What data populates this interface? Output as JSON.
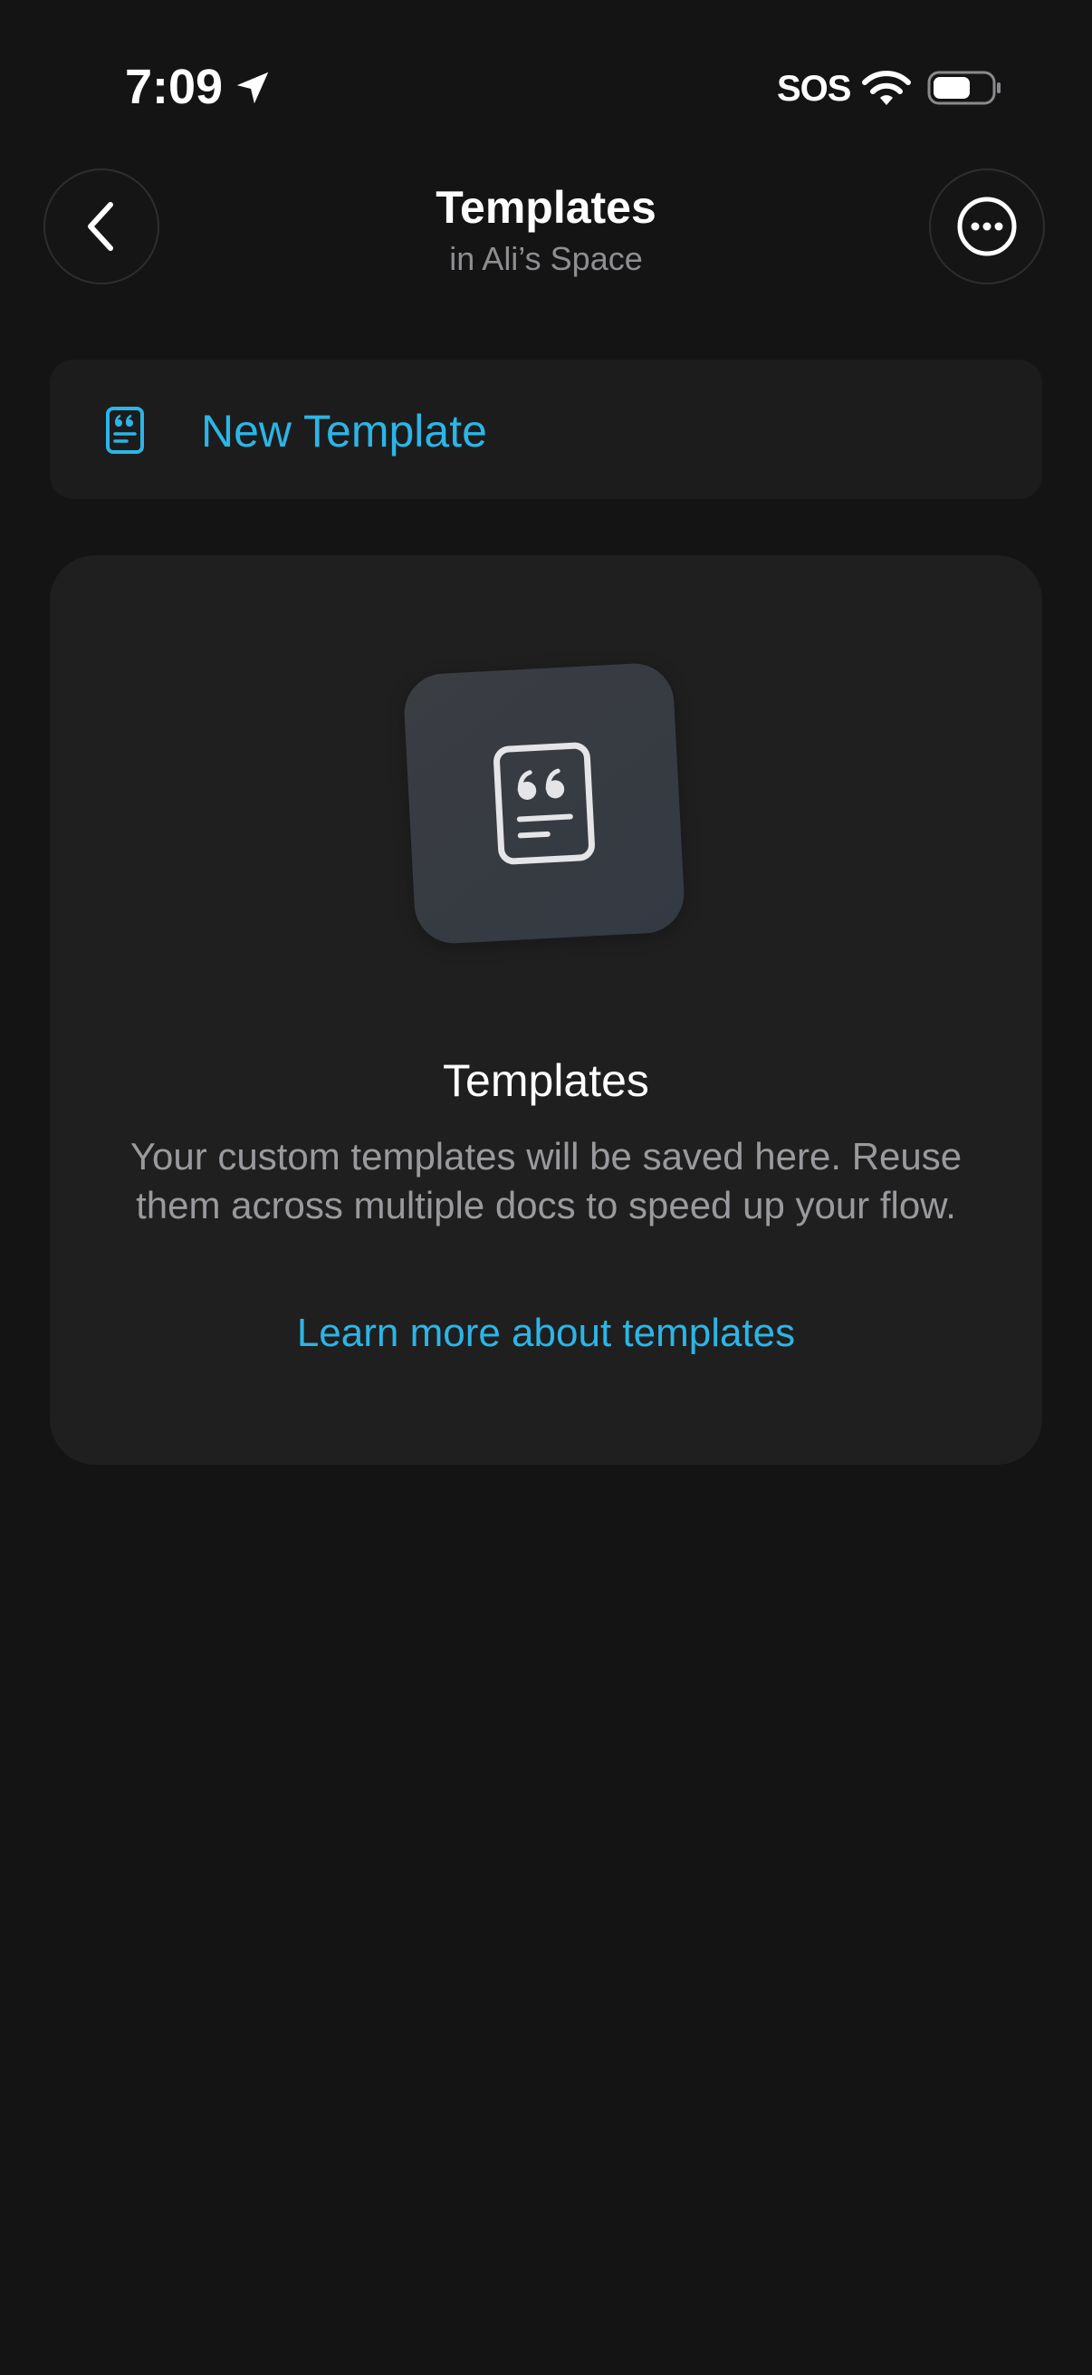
{
  "status_bar": {
    "time": "7:09",
    "sos": "SOS",
    "icons": [
      "location-arrow-icon",
      "wifi-icon",
      "battery-icon"
    ]
  },
  "nav": {
    "title": "Templates",
    "subtitle": "in Ali’s Space",
    "back_icon": "chevron-left-icon",
    "more_icon": "ellipsis-circle-icon"
  },
  "new_template": {
    "label": "New Template",
    "icon": "template-doc-icon"
  },
  "empty_state": {
    "title": "Templates",
    "description": "Your custom templates will be saved here. Reuse them across multiple docs to speed up your flow.",
    "link": "Learn more about templates",
    "icon": "template-doc-icon"
  },
  "colors": {
    "background": "#141414",
    "card": "#1f1f1f",
    "accent": "#2bb6e6",
    "secondary_text": "#9a9a9e"
  }
}
